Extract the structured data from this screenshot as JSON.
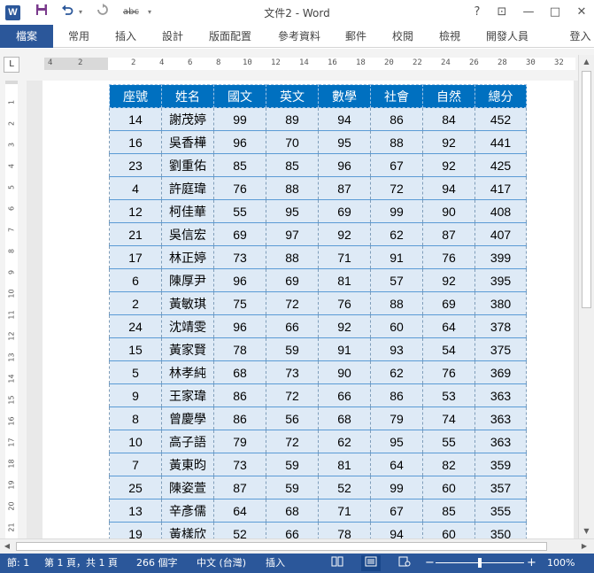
{
  "title_bar": {
    "app_icon": "W",
    "save_icon": "save-icon",
    "undo_icon": "undo-icon",
    "redo_icon": "redo-icon",
    "spelling_icon": "abc",
    "customize_icon": "▾",
    "title": "文件2 - Word",
    "help": "?",
    "ribbon_display": "⊡",
    "minimize": "—",
    "maximize": "□",
    "close": "✕"
  },
  "ribbon": {
    "tabs": [
      {
        "label": "檔案"
      },
      {
        "label": "常用"
      },
      {
        "label": "插入"
      },
      {
        "label": "設計"
      },
      {
        "label": "版面配置"
      },
      {
        "label": "參考資料"
      },
      {
        "label": "郵件"
      },
      {
        "label": "校閱"
      },
      {
        "label": "檢視"
      },
      {
        "label": "開發人員"
      },
      {
        "label": "登入"
      }
    ]
  },
  "ruler": {
    "tab_selector": "L",
    "h_ticks": [
      "4",
      "2",
      "2",
      "4",
      "6",
      "8",
      "10",
      "12",
      "14",
      "16",
      "18",
      "20",
      "22",
      "24",
      "26",
      "28",
      "30",
      "32"
    ],
    "v_ticks": [
      "1",
      "2",
      "3",
      "4",
      "5",
      "6",
      "7",
      "8",
      "9",
      "10",
      "11",
      "12",
      "13",
      "14",
      "15",
      "16",
      "17",
      "18",
      "19",
      "20",
      "21"
    ]
  },
  "table": {
    "headers": [
      "座號",
      "姓名",
      "國文",
      "英文",
      "數學",
      "社會",
      "自然",
      "總分"
    ],
    "rows": [
      [
        "14",
        "謝茂婷",
        "99",
        "89",
        "94",
        "86",
        "84",
        "452"
      ],
      [
        "16",
        "吳香樺",
        "96",
        "70",
        "95",
        "88",
        "92",
        "441"
      ],
      [
        "23",
        "劉重佑",
        "85",
        "85",
        "96",
        "67",
        "92",
        "425"
      ],
      [
        "4",
        "許庭瑋",
        "76",
        "88",
        "87",
        "72",
        "94",
        "417"
      ],
      [
        "12",
        "柯佳華",
        "55",
        "95",
        "69",
        "99",
        "90",
        "408"
      ],
      [
        "21",
        "吳信宏",
        "69",
        "97",
        "92",
        "62",
        "87",
        "407"
      ],
      [
        "17",
        "林正婷",
        "73",
        "88",
        "71",
        "91",
        "76",
        "399"
      ],
      [
        "6",
        "陳厚尹",
        "96",
        "69",
        "81",
        "57",
        "92",
        "395"
      ],
      [
        "2",
        "黃敏琪",
        "75",
        "72",
        "76",
        "88",
        "69",
        "380"
      ],
      [
        "24",
        "沈靖雯",
        "96",
        "66",
        "92",
        "60",
        "64",
        "378"
      ],
      [
        "15",
        "黃家賢",
        "78",
        "59",
        "91",
        "93",
        "54",
        "375"
      ],
      [
        "5",
        "林孝純",
        "68",
        "73",
        "90",
        "62",
        "76",
        "369"
      ],
      [
        "9",
        "王家瑋",
        "86",
        "72",
        "66",
        "86",
        "53",
        "363"
      ],
      [
        "8",
        "曾慶學",
        "86",
        "56",
        "68",
        "79",
        "74",
        "363"
      ],
      [
        "10",
        "高子語",
        "79",
        "72",
        "62",
        "95",
        "55",
        "363"
      ],
      [
        "7",
        "黃東昀",
        "73",
        "59",
        "81",
        "64",
        "82",
        "359"
      ],
      [
        "25",
        "陳姿萱",
        "87",
        "59",
        "52",
        "99",
        "60",
        "357"
      ],
      [
        "13",
        "辛彥儒",
        "64",
        "68",
        "71",
        "67",
        "85",
        "355"
      ],
      [
        "19",
        "黃樣欣",
        "52",
        "66",
        "78",
        "94",
        "60",
        "350"
      ]
    ]
  },
  "status_bar": {
    "section": "節: 1",
    "page": "第 1 頁，共 1 頁",
    "words": "266 個字",
    "language": "中文 (台灣)",
    "mode": "插入",
    "zoom_out": "−",
    "zoom_in": "+",
    "zoom": "100%",
    "zoom_fraction": 0.5
  },
  "colors": {
    "brand": "#2b579a",
    "table_header": "#0070c0",
    "table_row": "#deeaf6"
  }
}
